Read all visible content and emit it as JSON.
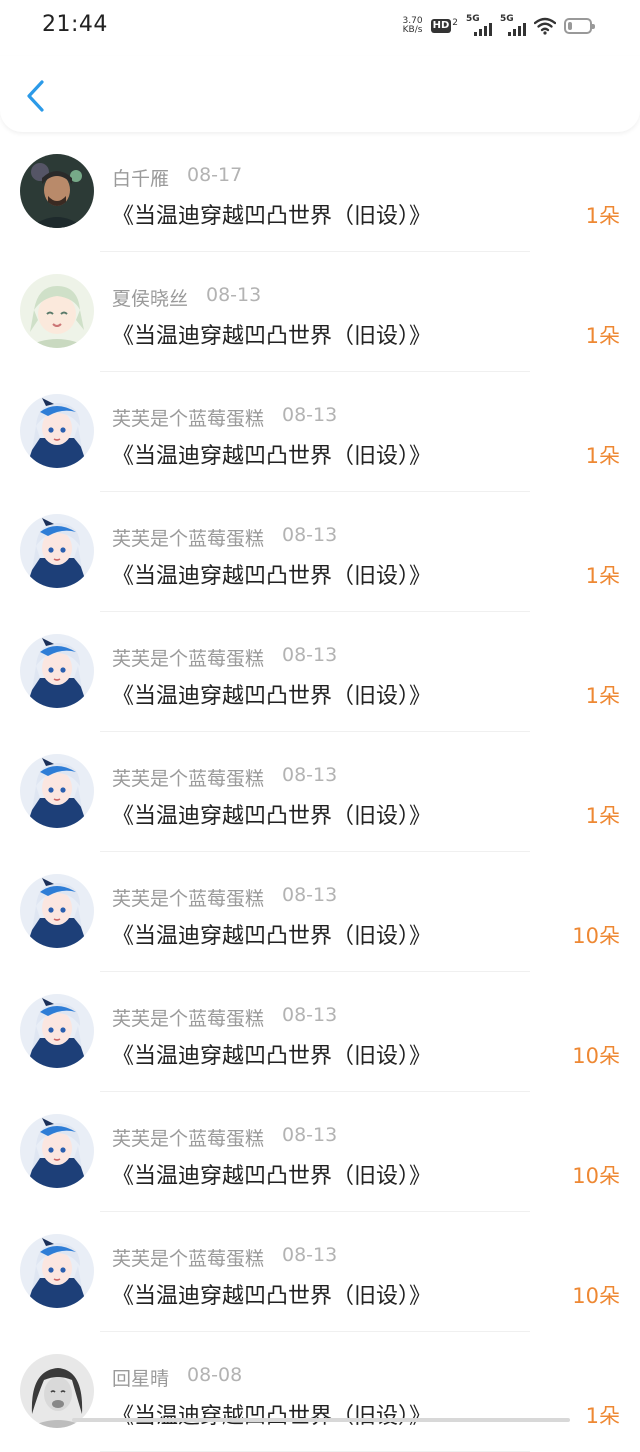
{
  "status_bar": {
    "time": "21:44",
    "net_speed_value": "3.70",
    "net_speed_unit": "KB/s",
    "hd_label": "HD",
    "hd_sub": "2",
    "sim1_gen": "5G",
    "sim2_gen": "5G"
  },
  "header": {
    "back_icon": "chevron-left-icon",
    "accent_color": "#2b9ae8"
  },
  "colors": {
    "amount": "#ee8833",
    "name": "#9a9a9a",
    "title": "#222222"
  },
  "records": [
    {
      "name": "白千雁",
      "date": "08-17",
      "book": "《当温迪穿越凹凸世界（旧设）》",
      "amount": "1朵",
      "avatar": "avatar-man"
    },
    {
      "name": "夏侯晓丝",
      "date": "08-13",
      "book": "《当温迪穿越凹凸世界（旧设）》",
      "amount": "1朵",
      "avatar": "avatar-anime-green"
    },
    {
      "name": "芙芙是个蓝莓蛋糕",
      "date": "08-13",
      "book": "《当温迪穿越凹凸世界（旧设）》",
      "amount": "1朵",
      "avatar": "avatar-anime-blue"
    },
    {
      "name": "芙芙是个蓝莓蛋糕",
      "date": "08-13",
      "book": "《当温迪穿越凹凸世界（旧设）》",
      "amount": "1朵",
      "avatar": "avatar-anime-blue"
    },
    {
      "name": "芙芙是个蓝莓蛋糕",
      "date": "08-13",
      "book": "《当温迪穿越凹凸世界（旧设）》",
      "amount": "1朵",
      "avatar": "avatar-anime-blue"
    },
    {
      "name": "芙芙是个蓝莓蛋糕",
      "date": "08-13",
      "book": "《当温迪穿越凹凸世界（旧设）》",
      "amount": "1朵",
      "avatar": "avatar-anime-blue"
    },
    {
      "name": "芙芙是个蓝莓蛋糕",
      "date": "08-13",
      "book": "《当温迪穿越凹凸世界（旧设）》",
      "amount": "10朵",
      "avatar": "avatar-anime-blue"
    },
    {
      "name": "芙芙是个蓝莓蛋糕",
      "date": "08-13",
      "book": "《当温迪穿越凹凸世界（旧设）》",
      "amount": "10朵",
      "avatar": "avatar-anime-blue"
    },
    {
      "name": "芙芙是个蓝莓蛋糕",
      "date": "08-13",
      "book": "《当温迪穿越凹凸世界（旧设）》",
      "amount": "10朵",
      "avatar": "avatar-anime-blue"
    },
    {
      "name": "芙芙是个蓝莓蛋糕",
      "date": "08-13",
      "book": "《当温迪穿越凹凸世界（旧设）》",
      "amount": "10朵",
      "avatar": "avatar-anime-blue"
    },
    {
      "name": "回星晴",
      "date": "08-08",
      "book": "《当温迪穿越凹凸世界（旧设）》",
      "amount": "1朵",
      "avatar": "avatar-woman"
    }
  ]
}
